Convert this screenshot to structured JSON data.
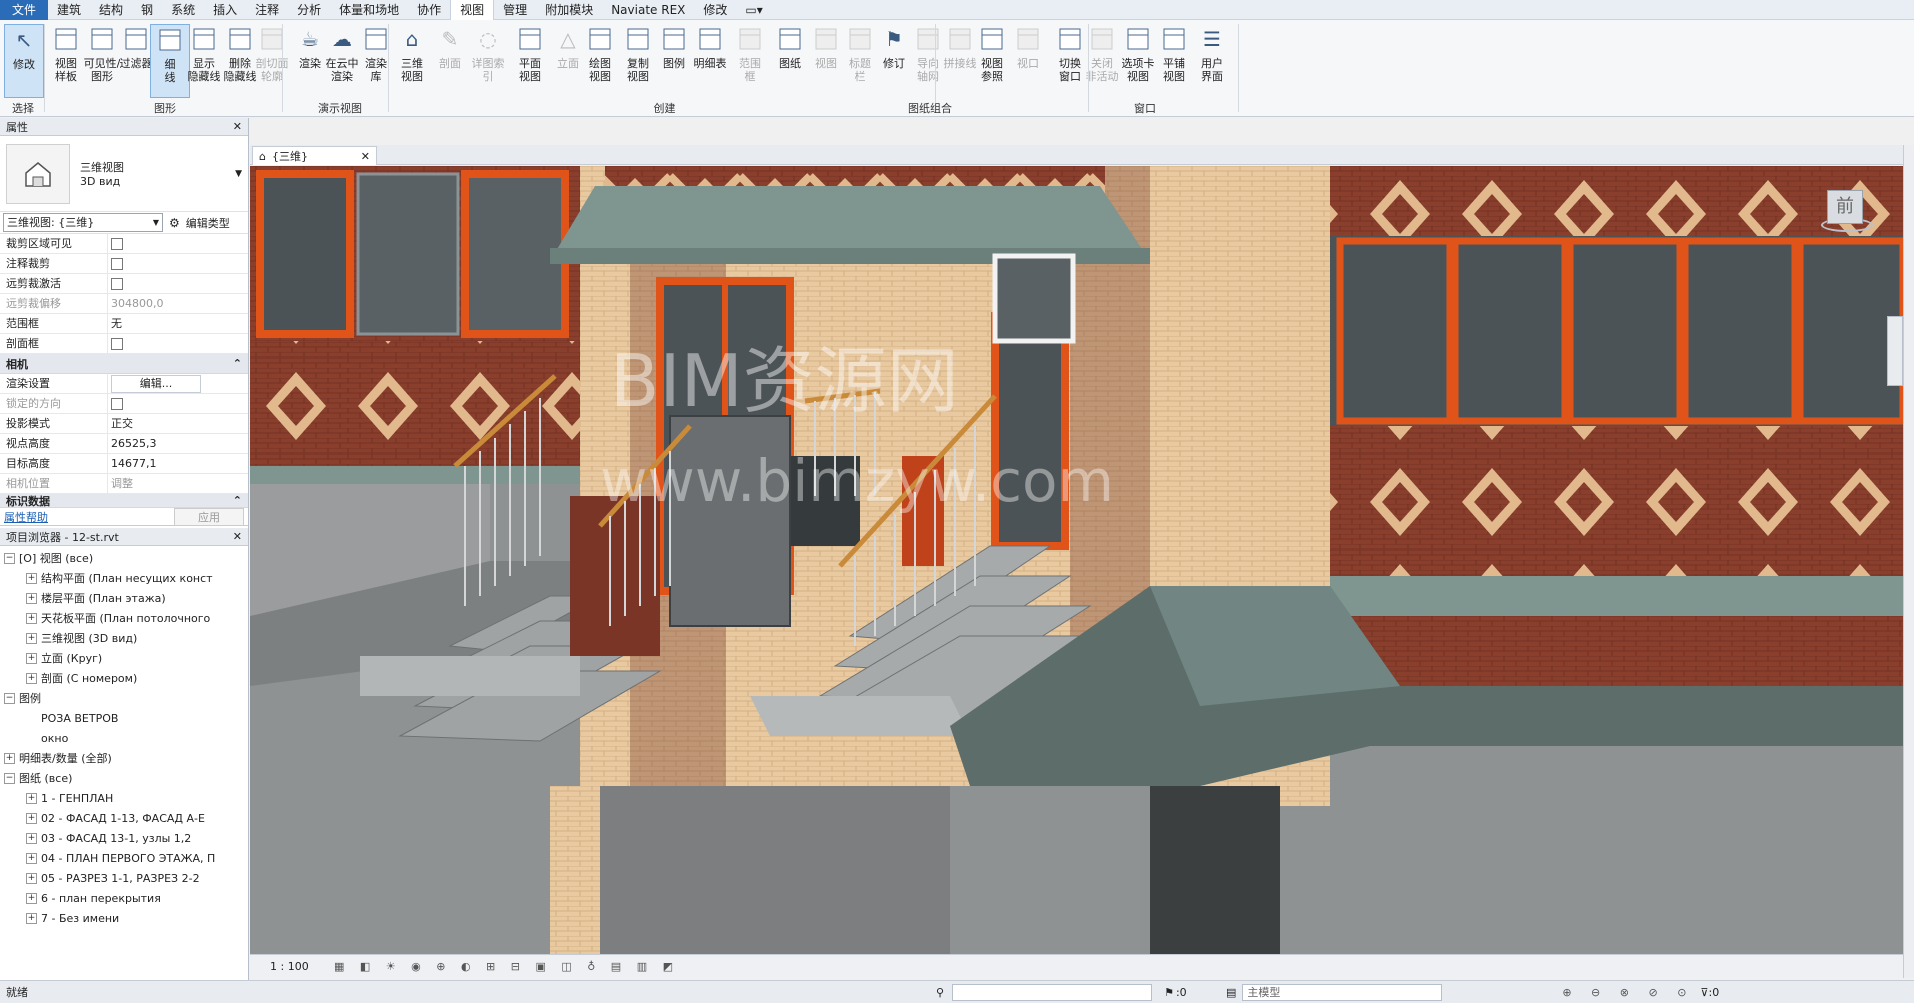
{
  "menu": {
    "items": [
      "文件",
      "建筑",
      "结构",
      "钢",
      "系统",
      "插入",
      "注释",
      "分析",
      "体量和场地",
      "协作",
      "视图",
      "管理",
      "附加模块",
      "Naviate REX",
      "修改"
    ],
    "active_index": 10
  },
  "ribbon": {
    "buttons": [
      {
        "label": "修改",
        "icon": "cursor-icon",
        "state": "selected"
      },
      {
        "label": "视图\n样板",
        "icon": "view-template-icon",
        "state": "normal"
      },
      {
        "label": "可见性/\n图形",
        "icon": "visibility-icon",
        "state": "normal"
      },
      {
        "label": "过滤器",
        "icon": "filter-icon",
        "state": "normal"
      },
      {
        "label": "细\n线",
        "icon": "thin-lines-icon",
        "state": "selected"
      },
      {
        "label": "显示\n隐藏线",
        "icon": "show-hidden-icon",
        "state": "normal"
      },
      {
        "label": "删除\n隐藏线",
        "icon": "remove-hidden-icon",
        "state": "normal"
      },
      {
        "label": "剖切面\n轮廓",
        "icon": "cut-profile-icon",
        "state": "disabled"
      },
      {
        "label": "渲染",
        "icon": "render-teapot-icon",
        "state": "normal"
      },
      {
        "label": "在云中\n渲染",
        "icon": "cloud-render-icon",
        "state": "normal"
      },
      {
        "label": "渲染\n库",
        "icon": "render-gallery-icon",
        "state": "normal"
      },
      {
        "label": "三维\n视图",
        "icon": "3d-view-icon",
        "state": "normal"
      },
      {
        "label": "剖面",
        "icon": "section-icon",
        "state": "disabled"
      },
      {
        "label": "详图索引",
        "icon": "callout-icon",
        "state": "disabled"
      },
      {
        "label": "平面\n视图",
        "icon": "plan-view-icon",
        "state": "normal"
      },
      {
        "label": "立面",
        "icon": "elevation-icon",
        "state": "disabled"
      },
      {
        "label": "绘图\n视图",
        "icon": "drafting-view-icon",
        "state": "normal"
      },
      {
        "label": "复制\n视图",
        "icon": "duplicate-view-icon",
        "state": "normal"
      },
      {
        "label": "图例",
        "icon": "legend-icon",
        "state": "normal"
      },
      {
        "label": "明细表",
        "icon": "schedule-icon",
        "state": "normal"
      },
      {
        "label": "范围\n框",
        "icon": "scope-box-icon",
        "state": "disabled"
      },
      {
        "label": "图纸",
        "icon": "sheet-icon",
        "state": "normal"
      },
      {
        "label": "视图",
        "icon": "view-on-sheet-icon",
        "state": "disabled"
      },
      {
        "label": "标题\n栏",
        "icon": "title-block-icon",
        "state": "disabled"
      },
      {
        "label": "修订",
        "icon": "revision-icon",
        "state": "normal"
      },
      {
        "label": "导向\n轴网",
        "icon": "guide-grid-icon",
        "state": "disabled"
      },
      {
        "label": "拼接线",
        "icon": "matchline-icon",
        "state": "disabled"
      },
      {
        "label": "视图\n参照",
        "icon": "view-reference-icon",
        "state": "normal"
      },
      {
        "label": "视口",
        "icon": "viewport-icon",
        "state": "disabled"
      },
      {
        "label": "切换\n窗口",
        "icon": "switch-windows-icon",
        "state": "normal"
      },
      {
        "label": "关闭\n非活动",
        "icon": "close-inactive-icon",
        "state": "disabled"
      },
      {
        "label": "选项卡\n视图",
        "icon": "tab-views-icon",
        "state": "normal"
      },
      {
        "label": "平铺\n视图",
        "icon": "tile-views-icon",
        "state": "normal"
      },
      {
        "label": "用户\n界面",
        "icon": "user-interface-icon",
        "state": "normal"
      }
    ],
    "groups": [
      "选择",
      "图形",
      "演示视图",
      "创建",
      "图纸组合",
      "窗口"
    ]
  },
  "properties": {
    "title": "属性",
    "type_name_line1": "三维视图",
    "type_name_line2": "3D вид",
    "selector_value": "三维视图: {三维}",
    "edit_type_label": "编辑类型",
    "rows_a": [
      {
        "k": "裁剪区域可见",
        "v": "",
        "checkbox": true,
        "gray": false
      },
      {
        "k": "注释裁剪",
        "v": "",
        "checkbox": true,
        "gray": false
      },
      {
        "k": "远剪裁激活",
        "v": "",
        "checkbox": true,
        "gray": false
      },
      {
        "k": "远剪裁偏移",
        "v": "304800,0",
        "checkbox": false,
        "gray": true
      },
      {
        "k": "范围框",
        "v": "无",
        "checkbox": false,
        "gray": false
      },
      {
        "k": "剖面框",
        "v": "",
        "checkbox": true,
        "gray": false
      }
    ],
    "camera_header": "相机",
    "rows_b": [
      {
        "k": "渲染设置",
        "v": "编辑...",
        "checkbox": false,
        "gray": false,
        "button": true
      },
      {
        "k": "锁定的方向",
        "v": "",
        "checkbox": true,
        "gray": true
      },
      {
        "k": "投影模式",
        "v": "正交",
        "checkbox": false,
        "gray": false
      },
      {
        "k": "视点高度",
        "v": "26525,3",
        "checkbox": false,
        "gray": false
      },
      {
        "k": "目标高度",
        "v": "14677,1",
        "checkbox": false,
        "gray": false
      },
      {
        "k": "相机位置",
        "v": "调整",
        "checkbox": false,
        "gray": true
      }
    ],
    "identity_header": "标识数据",
    "help_link": "属性帮助",
    "apply_label": "应用"
  },
  "browser": {
    "title": "项目浏览器 - 12-st.rvt",
    "nodes": [
      {
        "level": 0,
        "tog": "−",
        "text": "[O] 视图 (все)"
      },
      {
        "level": 1,
        "tog": "+",
        "text": "结构平面 (План несущих конст"
      },
      {
        "level": 1,
        "tog": "+",
        "text": "楼层平面 (План этажа)"
      },
      {
        "level": 1,
        "tog": "+",
        "text": "天花板平面 (План потолочного"
      },
      {
        "level": 1,
        "tog": "+",
        "text": "三维视图 (3D вид)"
      },
      {
        "level": 1,
        "tog": "+",
        "text": "立面 (Круг)"
      },
      {
        "level": 1,
        "tog": "+",
        "text": "剖面 (С номером)"
      },
      {
        "level": 0,
        "tog": "−",
        "text": "图例"
      },
      {
        "level": 1,
        "tog": "",
        "text": "РОЗА ВЕТРОВ"
      },
      {
        "level": 1,
        "tog": "",
        "text": "окно"
      },
      {
        "level": 0,
        "tog": "+",
        "text": "明细表/数量 (全部)"
      },
      {
        "level": 0,
        "tog": "−",
        "text": "图纸 (все)"
      },
      {
        "level": 1,
        "tog": "+",
        "text": "1 - ГЕНПЛАН"
      },
      {
        "level": 1,
        "tog": "+",
        "text": "02 - ФАСАД 1-13, ФАСАД А-Е"
      },
      {
        "level": 1,
        "tog": "+",
        "text": "03 - ФАСАД 13-1, узлы 1,2"
      },
      {
        "level": 1,
        "tog": "+",
        "text": "04 - ПЛАН ПЕРВОГО ЭТАЖА, П"
      },
      {
        "level": 1,
        "tog": "+",
        "text": "05 - РАЗРЕЗ 1-1, РАЗРЕЗ 2-2"
      },
      {
        "level": 1,
        "tog": "+",
        "text": "6 - план перекрытия"
      },
      {
        "level": 1,
        "tog": "+",
        "text": "7 - Без имени"
      }
    ]
  },
  "view_tab": {
    "label": "{三维}"
  },
  "viewcube": {
    "face_label": "前"
  },
  "view_control": {
    "scale": "1 : 100"
  },
  "status": {
    "text": "就绪",
    "sel_count_a": ":0",
    "model_label": "主模型",
    "sel_count_b": ":0"
  },
  "watermark": {
    "line1": "BIM资源网",
    "line2": "www.bimzyw.com"
  },
  "colors": {
    "accent": "#2b6cb8",
    "brick": "#8a3e2c",
    "window_frame": "#e0541a",
    "handrail": "#c98a3a"
  }
}
